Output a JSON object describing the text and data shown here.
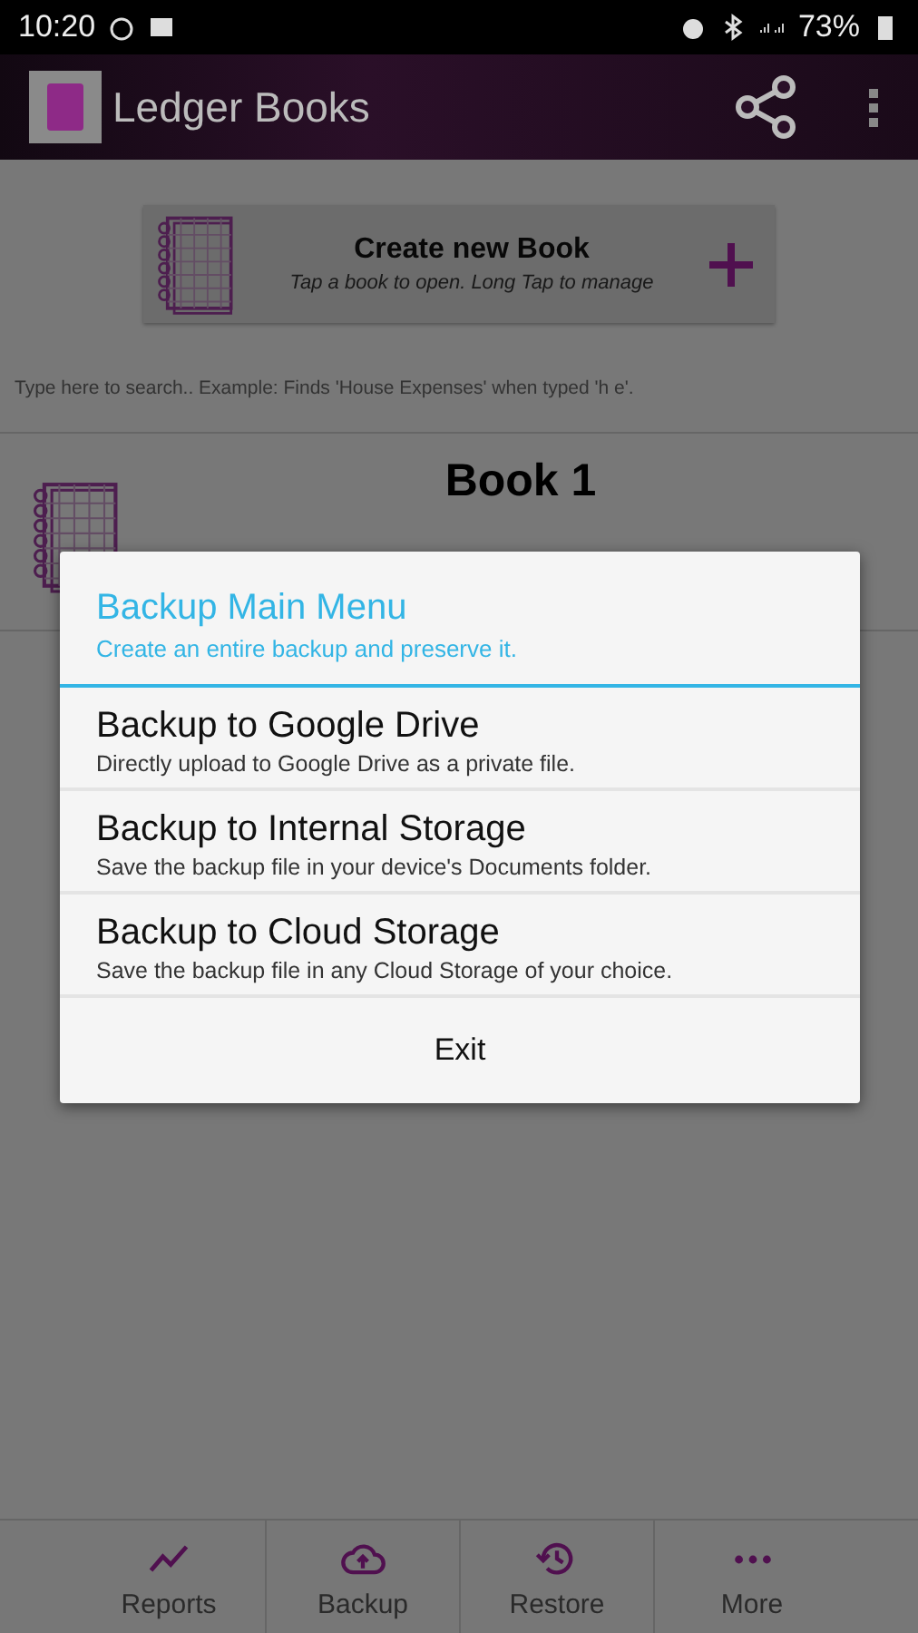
{
  "status_bar": {
    "time": "10:20",
    "battery": "73%"
  },
  "app_bar": {
    "title": "Ledger Books"
  },
  "create_book": {
    "title": "Create new Book",
    "hint": "Tap a book to open. Long Tap to manage"
  },
  "search": {
    "placeholder": "Type here to search.. Example: Finds 'House Expenses' when typed 'h e'."
  },
  "books": [
    {
      "title": "Book 1"
    }
  ],
  "dialog": {
    "title": "Backup Main Menu",
    "subtitle": "Create an entire backup and preserve it.",
    "options": [
      {
        "title": "Backup to Google Drive",
        "description": "Directly upload to Google Drive as a private file."
      },
      {
        "title": "Backup to Internal Storage",
        "description": "Save the backup file in your device's Documents folder."
      },
      {
        "title": "Backup to Cloud Storage",
        "description": "Save the backup file in any Cloud Storage of your choice."
      }
    ],
    "exit": "Exit"
  },
  "bottom_nav": [
    {
      "label": "Reports"
    },
    {
      "label": "Backup"
    },
    {
      "label": "Restore"
    },
    {
      "label": "More"
    }
  ]
}
